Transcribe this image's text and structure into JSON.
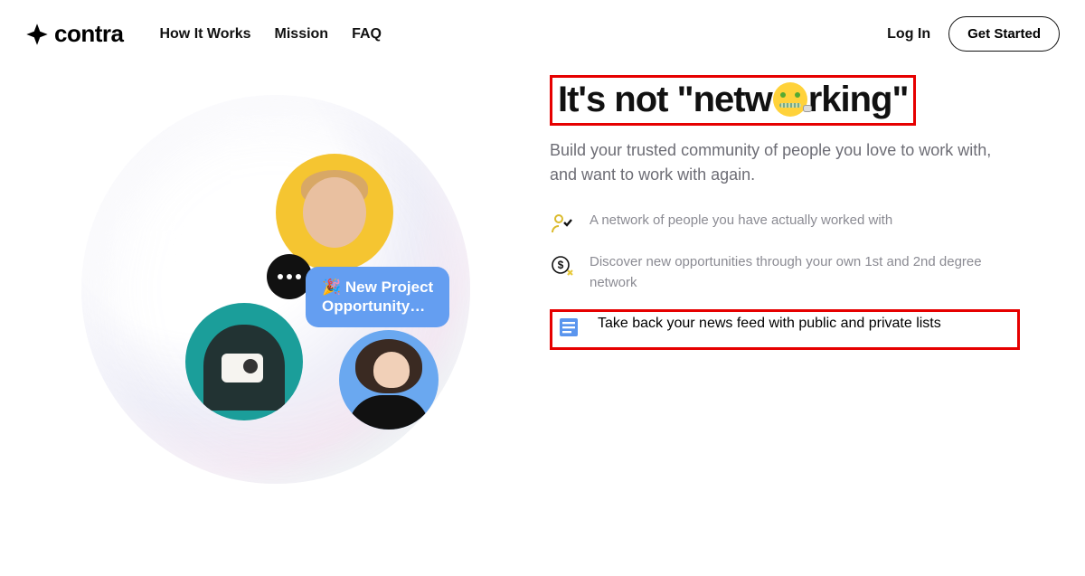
{
  "brand": "contra",
  "nav": {
    "how": "How It Works",
    "mission": "Mission",
    "faq": "FAQ"
  },
  "auth": {
    "login": "Log In",
    "getstarted": "Get Started"
  },
  "hero": {
    "headline_pre": "It's not \"netw",
    "headline_post": "rking\"",
    "subtitle": "Build your trusted community of people you love to work with, and want to work with again."
  },
  "features": {
    "f1": "A network of people you have actually worked with",
    "f2": "Discover new opportunities through your own 1st and 2nd degree network",
    "f3": "Take back your news feed with public and private lists"
  },
  "card": {
    "emoji": "🎉",
    "line1": "New Project",
    "line2": "Opportunity…"
  }
}
